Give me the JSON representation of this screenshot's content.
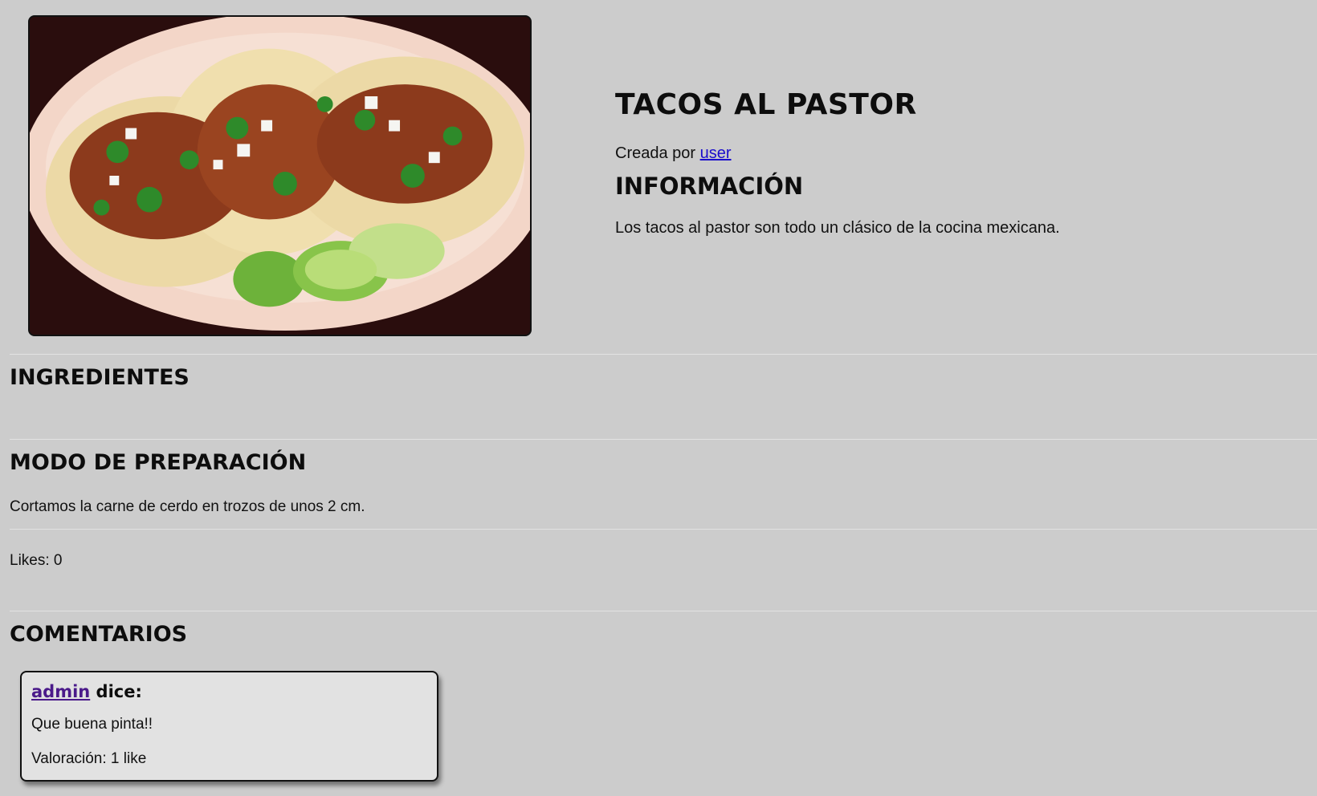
{
  "recipe": {
    "title": "TACOS AL PASTOR",
    "created_by_prefix": "Creada por",
    "author": "user",
    "info_heading": "INFORMACIÓN",
    "info_text": "Los tacos al pastor son todo un clásico de la cocina mexicana.",
    "image_icon": "tacos-photo"
  },
  "ingredients": {
    "heading": "INGREDIENTES"
  },
  "preparation": {
    "heading": "MODO DE PREPARACIÓN",
    "text": "Cortamos la carne de cerdo en trozos de unos 2 cm."
  },
  "likes": {
    "label": "Likes: 0"
  },
  "comments": {
    "heading": "COMENTARIOS",
    "items": [
      {
        "user": "admin",
        "says": "dice:",
        "text": "Que buena pinta!!",
        "rating": "Valoración: 1 like"
      }
    ]
  },
  "colors": {
    "background": "#cccccc",
    "link": "#1a0dcc",
    "visited_link": "#4b1a8a",
    "comment_bg": "#e2e2e2"
  }
}
